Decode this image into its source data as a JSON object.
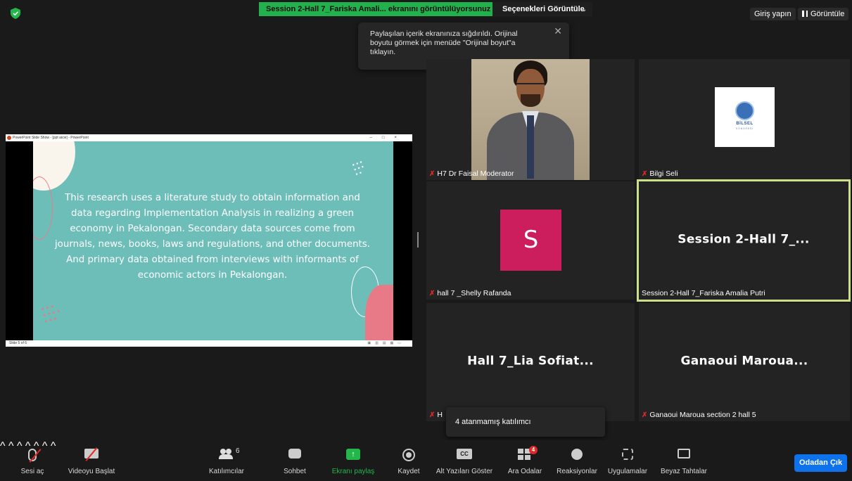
{
  "top": {
    "share_banner": "Session 2-Hall 7_Fariska Amali... ekranını görüntülüyorsunuz",
    "options_label": "Seçenekleri Görüntüle",
    "signin_label": "Giriş yapın",
    "view_label": "Görüntüle"
  },
  "tooltip": {
    "text": "Paylaşılan içerik ekranınıza sığdırıldı. Orijinal boyutu görmek için menüde \"Orijinal boyut\"a tıklayın."
  },
  "shared_window": {
    "title": "PowerPoint Slide Show - [ppt aicie] - PowerPoint",
    "slide_text": "This research uses a literature study to obtain information and data regarding Implementation Analysis in realizing a green economy in Pekalongan. Secondary data sources come from journals, news, books, laws and regulations, and other documents. And primary data obtained from interviews with informants of economic actors in Pekalongan.",
    "status": "Slide 5 of 6"
  },
  "tiles": [
    {
      "name": "H7 Dr Faisal Moderator"
    },
    {
      "name": "Bilgi Seli",
      "logo_text": "BİLSEL",
      "logo_sub": "KONGRESİ"
    },
    {
      "name": "hall 7 _Shelly Rafanda",
      "avatar": "S"
    },
    {
      "name": "Session 2-Hall 7_Fariska Amalia Putri",
      "big": "Session 2-Hall 7_..."
    },
    {
      "name": "H",
      "big": "Hall 7_Lia Sofiat..."
    },
    {
      "name": "Ganaoui Maroua section 2 hall 5",
      "big": "Ganaoui  Maroua..."
    }
  ],
  "popup": {
    "text": "4 atanmamış katılımcı"
  },
  "toolbar": {
    "mute": "Sesi aç",
    "video": "Videoyu Başlat",
    "participants": "Katılımcılar",
    "participants_count": "6",
    "chat": "Sohbet",
    "share": "Ekranı paylaş",
    "record": "Kaydet",
    "captions": "Alt Yazıları Göster",
    "cc": "CC",
    "breakout": "Ara Odalar",
    "breakout_badge": "4",
    "reactions": "Reaksiyonlar",
    "apps": "Uygulamalar",
    "whiteboard": "Beyaz Tahtalar",
    "leave": "Odadan Çık"
  },
  "colors": {
    "accent": "#0e72ed",
    "share_green": "#22b14c",
    "mute_red": "#e02828",
    "active_speaker": "#cbe08a"
  }
}
